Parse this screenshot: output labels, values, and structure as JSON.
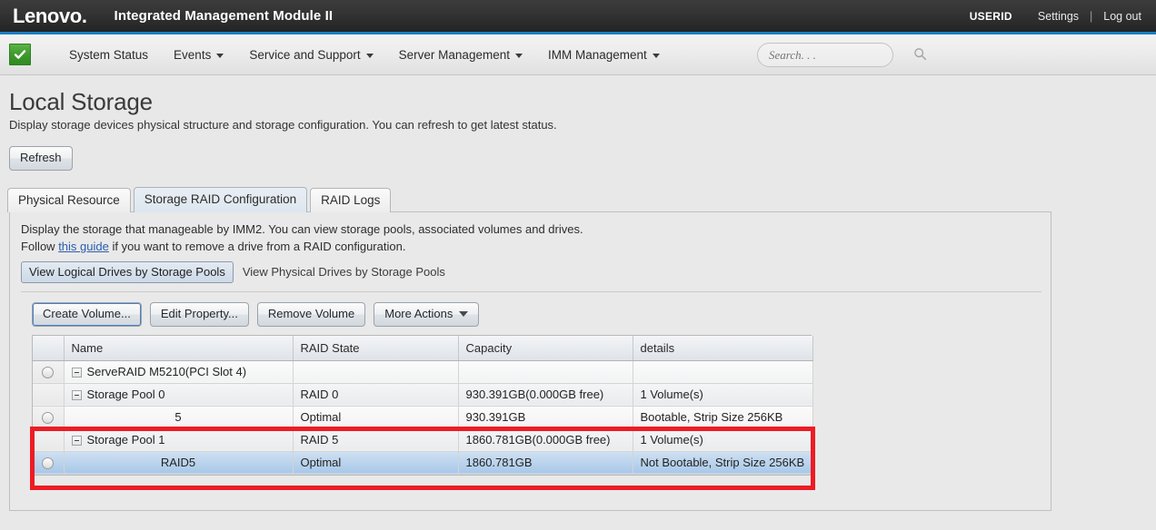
{
  "header": {
    "brand": "Lenovo",
    "brand_dot": ".",
    "title": "Integrated Management Module II",
    "userid": "USERID",
    "settings_label": "Settings",
    "separator": "|",
    "logout_label": "Log out"
  },
  "nav": {
    "status_icon": "green-check-icon",
    "items": [
      {
        "label": "System Status",
        "has_caret": false
      },
      {
        "label": "Events",
        "has_caret": true
      },
      {
        "label": "Service and Support",
        "has_caret": true
      },
      {
        "label": "Server Management",
        "has_caret": true
      },
      {
        "label": "IMM Management",
        "has_caret": true
      }
    ],
    "search": {
      "placeholder": "Search. . .",
      "value": "",
      "icon": "search-icon"
    }
  },
  "page": {
    "title": "Local Storage",
    "description": "Display storage devices physical structure and storage configuration. You can refresh to get latest status.",
    "refresh_label": "Refresh"
  },
  "tabs": [
    {
      "label": "Physical Resource",
      "active": false
    },
    {
      "label": "Storage RAID Configuration",
      "active": true
    },
    {
      "label": "RAID Logs",
      "active": false
    }
  ],
  "panel": {
    "desc_line1": "Display the storage that manageable by IMM2. You can view storage pools, associated volumes and drives.",
    "desc_line2_pre": "Follow ",
    "desc_link": "this guide",
    "desc_line2_post": " if you want to remove a drive from a RAID configuration.",
    "view_logical_label": "View Logical Drives by Storage Pools",
    "view_physical_label": "View Physical Drives by Storage Pools",
    "actions": [
      {
        "label": "Create Volume...",
        "focused": true,
        "caret": false
      },
      {
        "label": "Edit Property...",
        "focused": false,
        "caret": false
      },
      {
        "label": "Remove Volume",
        "focused": false,
        "caret": false
      },
      {
        "label": "More Actions",
        "focused": false,
        "caret": true
      }
    ]
  },
  "table": {
    "columns": [
      "",
      "Name",
      "RAID State",
      "Capacity",
      "details"
    ],
    "rows": [
      {
        "kind": "device",
        "radio": true,
        "twisty": true,
        "indent": 1,
        "name": "ServeRAID M5210(PCI Slot 4)",
        "raid_state": "",
        "capacity": "",
        "details": "",
        "highlighted": false,
        "selected": false
      },
      {
        "kind": "pool",
        "radio": false,
        "twisty": true,
        "indent": 2,
        "name": "Storage Pool 0",
        "raid_state": "RAID 0",
        "capacity": "930.391GB(0.000GB free)",
        "details": "1 Volume(s)",
        "highlighted": false,
        "selected": false
      },
      {
        "kind": "volume",
        "radio": true,
        "twisty": false,
        "indent": 0,
        "name": "5",
        "raid_state": "Optimal",
        "capacity": "930.391GB",
        "details": "Bootable, Strip Size 256KB",
        "highlighted": false,
        "selected": false
      },
      {
        "kind": "pool",
        "radio": false,
        "twisty": true,
        "indent": 2,
        "name": "Storage Pool 1",
        "raid_state": "RAID 5",
        "capacity": "1860.781GB(0.000GB free)",
        "details": "1 Volume(s)",
        "highlighted": true,
        "selected": false
      },
      {
        "kind": "volume",
        "radio": true,
        "twisty": false,
        "indent": 0,
        "name": "RAID5",
        "raid_state": "Optimal",
        "capacity": "1860.781GB",
        "details": "Not Bootable, Strip Size 256KB",
        "highlighted": true,
        "selected": true
      }
    ]
  },
  "colors": {
    "brand_bar": "#2b2b2b",
    "accent_blue": "#1b7fc4",
    "highlight_red": "#ed1c24",
    "selected_row": "#a8c8e8",
    "link": "#2a5db0",
    "status_green": "#3e9b2c"
  }
}
